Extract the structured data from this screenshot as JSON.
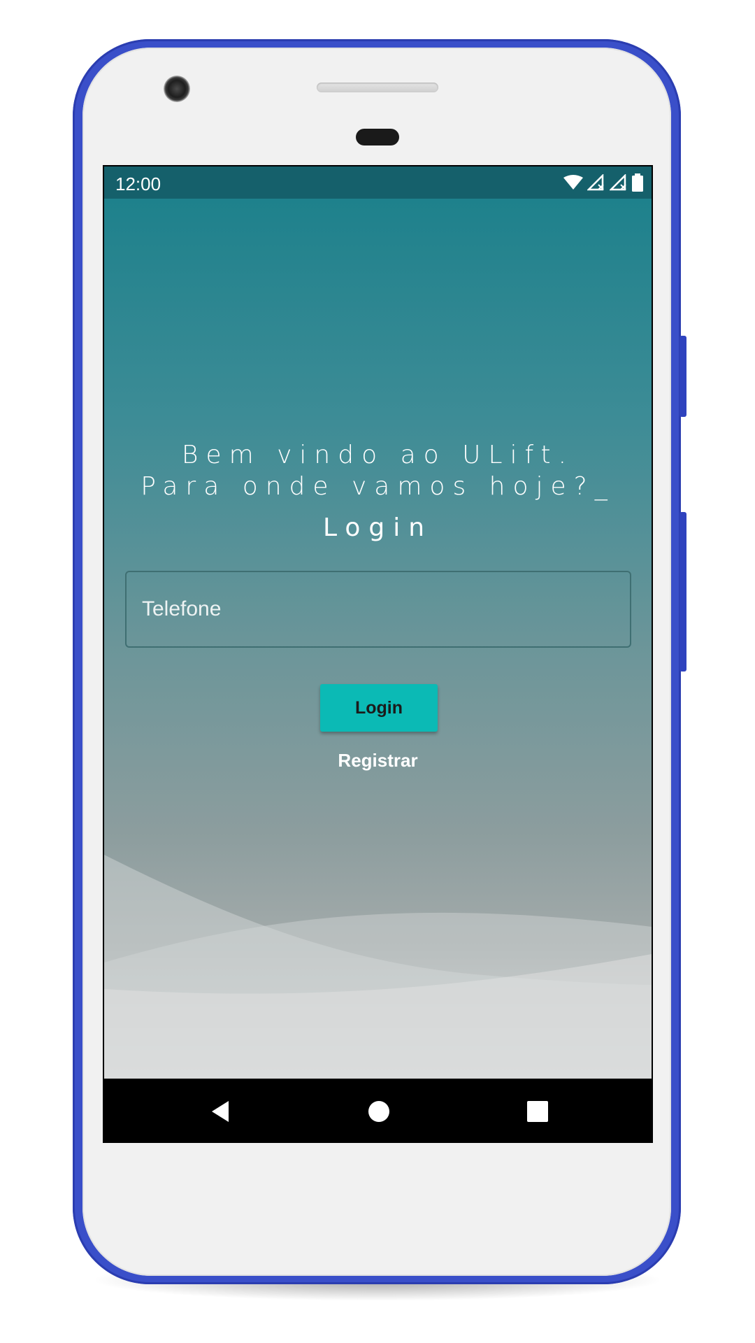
{
  "status_bar": {
    "time": "12:00",
    "icons": [
      "wifi-icon",
      "signal-no-data-icon",
      "signal-no-data-icon",
      "battery-icon"
    ]
  },
  "app": {
    "welcome_text": "Bem vindo ao ULift. Para onde vamos hoje?_",
    "login_title": "Login",
    "phone_input": {
      "placeholder": "Telefone",
      "value": ""
    },
    "login_button_label": "Login",
    "register_link_label": "Registrar"
  },
  "nav_bar": {
    "icons": [
      "back-icon",
      "home-icon",
      "recents-icon"
    ]
  },
  "colors": {
    "device_frame": "#3a4fc9",
    "status_bar": "#15606b",
    "gradient_top": "#1e818c",
    "login_button": "#0bbab5",
    "nav_bar": "#000000"
  }
}
